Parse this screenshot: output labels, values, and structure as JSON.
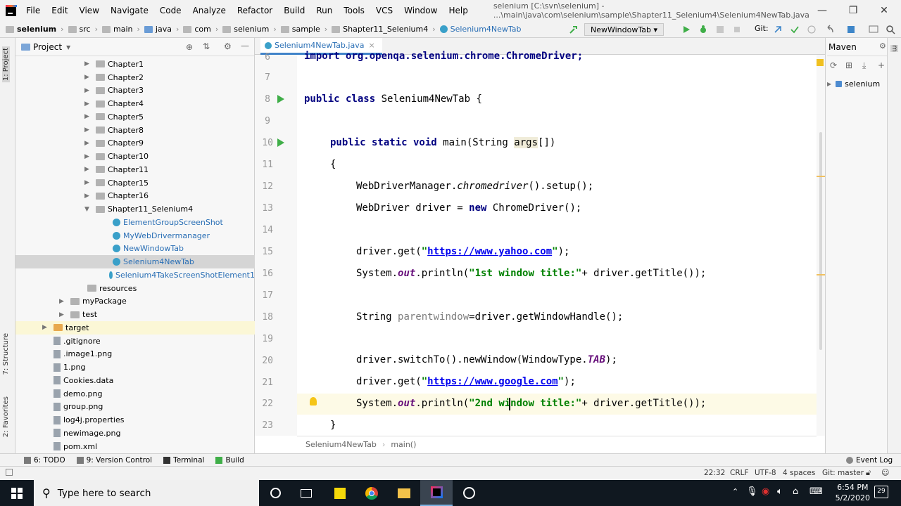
{
  "menu": {
    "items": [
      "File",
      "Edit",
      "View",
      "Navigate",
      "Code",
      "Analyze",
      "Refactor",
      "Build",
      "Run",
      "Tools",
      "VCS",
      "Window",
      "Help"
    ],
    "window_title": "selenium [C:\\svn\\selenium] - ...\\main\\java\\com\\selenium\\sample\\Shapter11_Selenium4\\Selenium4NewTab.java"
  },
  "navbar": {
    "crumbs": [
      "selenium",
      "src",
      "main",
      "java",
      "com",
      "selenium",
      "sample",
      "Shapter11_Selenium4",
      "Selenium4NewTab"
    ],
    "run_config": "NewWindowTab",
    "git_label": "Git:"
  },
  "left_strip": {
    "project_tab": "1: Project",
    "structure_tab": "7: Structure",
    "favorites_tab": "2: Favorites"
  },
  "project": {
    "title": "Project",
    "tree": [
      {
        "label": "Chapter1",
        "kind": "folder",
        "depth": 2,
        "arrow": "▶"
      },
      {
        "label": "Chapter2",
        "kind": "folder",
        "depth": 2,
        "arrow": "▶"
      },
      {
        "label": "Chapter3",
        "kind": "folder",
        "depth": 2,
        "arrow": "▶"
      },
      {
        "label": "Chapter4",
        "kind": "folder",
        "depth": 2,
        "arrow": "▶"
      },
      {
        "label": "Chapter5",
        "kind": "folder",
        "depth": 2,
        "arrow": "▶"
      },
      {
        "label": "Chapter8",
        "kind": "folder",
        "depth": 2,
        "arrow": "▶"
      },
      {
        "label": "Chapter9",
        "kind": "folder",
        "depth": 2,
        "arrow": "▶"
      },
      {
        "label": "Chapter10",
        "kind": "folder",
        "depth": 2,
        "arrow": "▶"
      },
      {
        "label": "Chapter11",
        "kind": "folder",
        "depth": 2,
        "arrow": "▶"
      },
      {
        "label": "Chapter15",
        "kind": "folder",
        "depth": 2,
        "arrow": "▶"
      },
      {
        "label": "Chapter16",
        "kind": "folder",
        "depth": 2,
        "arrow": "▶"
      },
      {
        "label": "Shapter11_Selenium4",
        "kind": "folder",
        "depth": 2,
        "arrow": "▼"
      },
      {
        "label": "ElementGroupScreenShot",
        "kind": "class",
        "depth": 3,
        "arrow": ""
      },
      {
        "label": "MyWebDrivermanager",
        "kind": "class",
        "depth": 3,
        "arrow": ""
      },
      {
        "label": "NewWindowTab",
        "kind": "class",
        "depth": 3,
        "arrow": ""
      },
      {
        "label": "Selenium4NewTab",
        "kind": "class",
        "depth": 3,
        "arrow": "",
        "selected": true
      },
      {
        "label": "Selenium4TakeScreenShotElement1",
        "kind": "class",
        "depth": 3,
        "arrow": ""
      },
      {
        "label": "resources",
        "kind": "folder",
        "depth": 1.5,
        "arrow": ""
      },
      {
        "label": "myPackage",
        "kind": "folder",
        "depth": 0.5,
        "arrow": "▶"
      },
      {
        "label": "test",
        "kind": "folder",
        "depth": 0.5,
        "arrow": "▶"
      },
      {
        "label": "target",
        "kind": "orange",
        "depth": -0.5,
        "arrow": "▶",
        "yellow": true
      },
      {
        "label": ".gitignore",
        "kind": "file",
        "depth": -0.5,
        "arrow": ""
      },
      {
        "label": ".image1.png",
        "kind": "file",
        "depth": -0.5,
        "arrow": ""
      },
      {
        "label": "1.png",
        "kind": "file",
        "depth": -0.5,
        "arrow": ""
      },
      {
        "label": "Cookies.data",
        "kind": "file",
        "depth": -0.5,
        "arrow": ""
      },
      {
        "label": "demo.png",
        "kind": "file",
        "depth": -0.5,
        "arrow": ""
      },
      {
        "label": "group.png",
        "kind": "file",
        "depth": -0.5,
        "arrow": ""
      },
      {
        "label": "log4j.properties",
        "kind": "file",
        "depth": -0.5,
        "arrow": ""
      },
      {
        "label": "newimage.png",
        "kind": "file",
        "depth": -0.5,
        "arrow": ""
      },
      {
        "label": "pom.xml",
        "kind": "file",
        "depth": -0.5,
        "arrow": ""
      }
    ]
  },
  "editor": {
    "tab_label": "Selenium4NewTab.java",
    "line_numbers": [
      "6",
      "7",
      "8",
      "9",
      "10",
      "11",
      "12",
      "13",
      "14",
      "15",
      "16",
      "17",
      "18",
      "19",
      "20",
      "21",
      "22",
      "23"
    ],
    "breadcrumb_class": "Selenium4NewTab",
    "breadcrumb_method": "main()",
    "code": {
      "l6": "import org.openqa.selenium.chrome.ChromeDriver;",
      "l8_kw": "public class",
      "l8_name": " Selenium4NewTab {",
      "l10_kw": "public static void",
      "l10_a": " main(String ",
      "l10_param": "args",
      "l10_b": "[])",
      "l11": "{",
      "l12_a": "WebDriverManager.",
      "l12_it": "chromedriver",
      "l12_b": "().setup();",
      "l13_a": "WebDriver driver = ",
      "l13_kw": "new",
      "l13_b": " ChromeDriver();",
      "l15_a": "driver.get(",
      "l15_q1": "\"",
      "l15_url": "https://www.yahoo.com",
      "l15_q2": "\"",
      "l15_b": ");",
      "l16_a": "System.",
      "l16_out": "out",
      "l16_b": ".println(",
      "l16_str": "\"1st window title:\"",
      "l16_c": "+ driver.getTitle());",
      "l18_a": "String ",
      "l18_var": "parentwindow",
      "l18_b": "=driver.getWindowHandle();",
      "l20_a": "driver.switchTo().newWindow(WindowType.",
      "l20_tab": "TAB",
      "l20_b": ");",
      "l21_a": "driver.get(",
      "l21_q1": "\"",
      "l21_url": "https://www.google.com",
      "l21_q2": "\"",
      "l21_b": ");",
      "l22_a": "System.",
      "l22_out": "out",
      "l22_b": ".println(",
      "l22_str": "\"2nd window title:\"",
      "l22_c": "+ driver.getTitle());",
      "l23": "}"
    }
  },
  "maven": {
    "title": "Maven",
    "item": "selenium"
  },
  "bottom_tools": [
    "6: TODO",
    "9: Version Control",
    "Terminal",
    "Build",
    "Event Log"
  ],
  "status": {
    "position": "22:32",
    "line_sep": "CRLF",
    "encoding": "UTF-8",
    "indent": "4 spaces",
    "vcs": "Git: master"
  },
  "taskbar": {
    "search_placeholder": "Type here to search",
    "time": "6:54 PM",
    "date": "5/2/2020",
    "notif_count": "29"
  }
}
